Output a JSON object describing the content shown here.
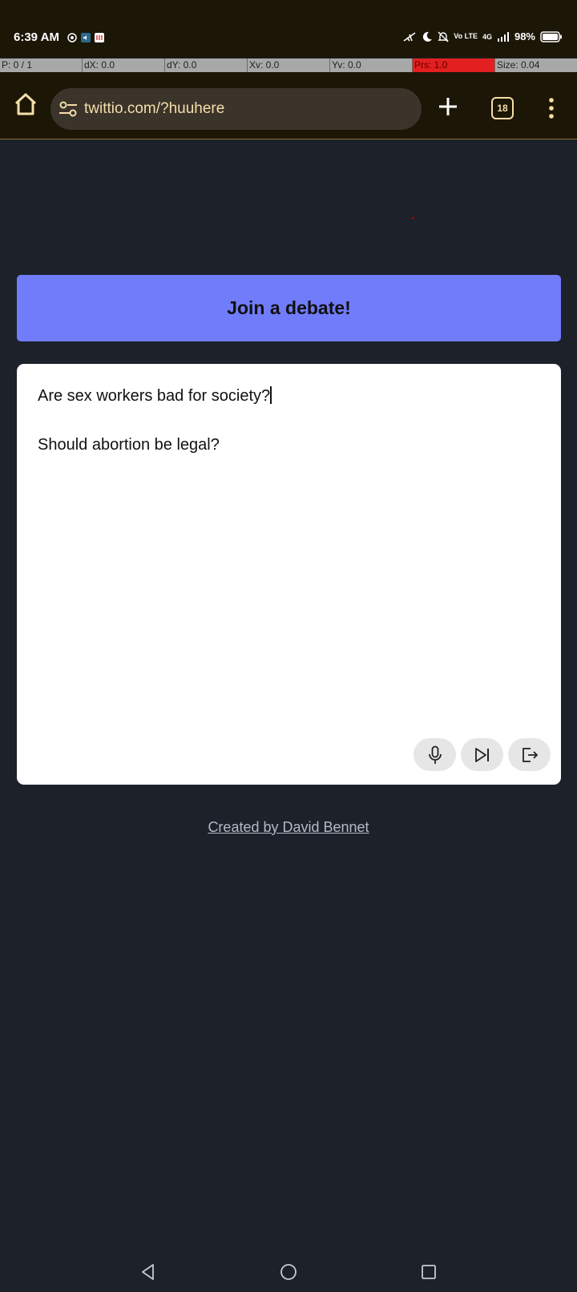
{
  "status_bar": {
    "time": "6:39 AM",
    "network": "4G",
    "volte": "Vo LTE",
    "battery": "98%"
  },
  "debug_bar": {
    "p": "P: 0 / 1",
    "dx": "dX: 0.0",
    "dy": "dY: 0.0",
    "xv": "Xv: 0.0",
    "yv": "Yv: 0.0",
    "prs": "Prs: 1.0",
    "size": "Size: 0.04"
  },
  "browser": {
    "url": "twittio.com/?huuhere",
    "tab_count": "18"
  },
  "page": {
    "join_button": "Join a debate!",
    "topics": [
      "Are sex workers bad for society?",
      "Should abortion be legal?"
    ],
    "credit": "Created by David Bennet"
  },
  "colors": {
    "background": "#1d212a",
    "accent": "#717cfa",
    "browser_chrome": "#1c1607",
    "url_text": "#f5deaa"
  },
  "icons": {
    "home": "home-icon",
    "site_settings": "tune-icon",
    "new_tab": "plus-icon",
    "menu": "more-vert-icon",
    "mic": "microphone-icon",
    "skip": "skip-next-icon",
    "leave": "exit-icon"
  }
}
